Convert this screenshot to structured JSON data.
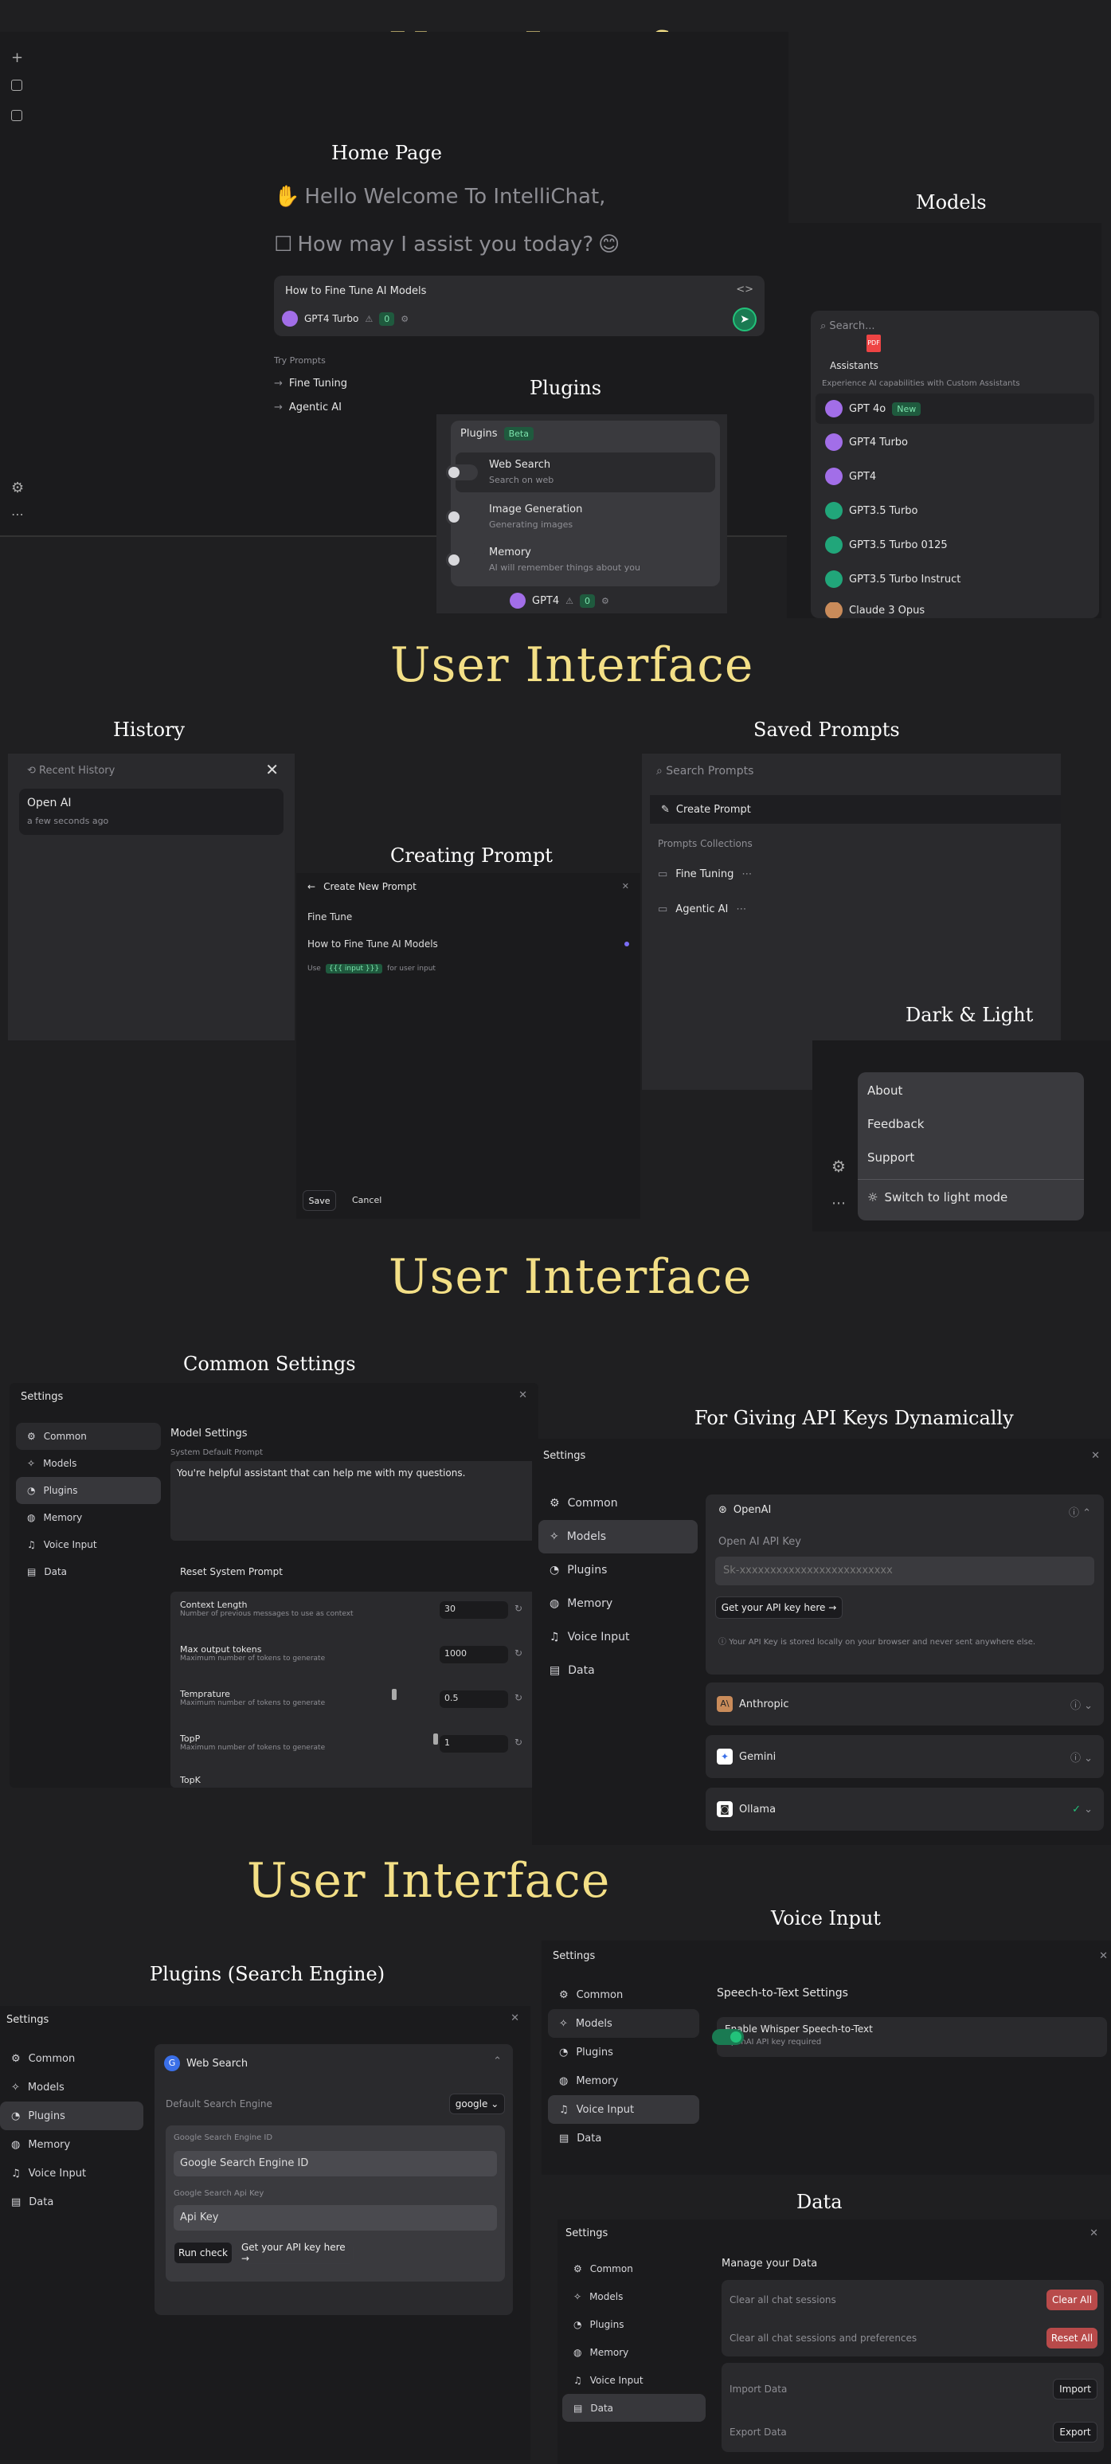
{
  "sections": [
    {
      "title": "User Interface"
    },
    {
      "title": "User Interface"
    },
    {
      "title": "User Interface"
    },
    {
      "title": "User Interface"
    }
  ],
  "home": {
    "label": "Home Page",
    "greeting1": "Hello Welcome To IntelliChat,",
    "greeting2": "How may I assist you today?",
    "greeting2_emoji": "😊",
    "input_value": "How to Fine Tune AI Models",
    "model_name": "GPT4 Turbo",
    "badge_count": "0",
    "try_prompts_label": "Try Prompts",
    "prompts": [
      "Fine Tuning",
      "Agentic AI"
    ]
  },
  "models": {
    "label": "Models",
    "search_placeholder": "Search...",
    "assistants_label": "Assistants",
    "assistants_desc": "Experience AI capabilities with Custom Assistants",
    "new_badge": "New",
    "items": [
      {
        "name": "GPT 4o",
        "color": "#a26ee8"
      },
      {
        "name": "GPT4 Turbo",
        "color": "#a26ee8"
      },
      {
        "name": "GPT4",
        "color": "#a26ee8"
      },
      {
        "name": "GPT3.5 Turbo",
        "color": "#21a67a"
      },
      {
        "name": "GPT3.5 Turbo 0125",
        "color": "#21a67a"
      },
      {
        "name": "GPT3.5 Turbo Instruct",
        "color": "#21a67a"
      },
      {
        "name": "Claude 3 Opus",
        "color": "#c98b5a"
      }
    ]
  },
  "plugins_popup": {
    "label": "Plugins",
    "header": "Plugins",
    "beta": "Beta",
    "items": [
      {
        "title": "Web Search",
        "desc": "Search on web"
      },
      {
        "title": "Image Generation",
        "desc": "Generating images"
      },
      {
        "title": "Memory",
        "desc": "AI will remember things about you"
      }
    ],
    "footer_model": "GPT4",
    "footer_count": "0"
  },
  "history": {
    "label": "History",
    "header": "Recent History",
    "item_title": "Open AI",
    "item_time": "a few seconds ago"
  },
  "saved_prompts": {
    "label": "Saved Prompts",
    "search_placeholder": "Search Prompts",
    "create": "Create Prompt",
    "collections_label": "Prompts Collections",
    "items": [
      "Fine Tuning",
      "Agentic AI"
    ]
  },
  "creating_prompt": {
    "label": "Creating Prompt",
    "header": "Create New Prompt",
    "name_value": "Fine Tune",
    "content_value": "How to Fine Tune AI Models",
    "hint_use": "Use",
    "hint_tag": "{{{ input }}}",
    "hint_rest": "for user input",
    "save": "Save",
    "cancel": "Cancel"
  },
  "dark_light": {
    "label": "Dark & Light",
    "items": [
      "About",
      "Feedback",
      "Support"
    ],
    "switch": "Switch to light mode"
  },
  "settings_nav": [
    "Common",
    "Models",
    "Plugins",
    "Memory",
    "Voice Input",
    "Data"
  ],
  "settings_title": "Settings",
  "common_settings": {
    "label": "Common Settings",
    "heading": "Model Settings",
    "system_prompt_label": "System Default Prompt",
    "system_prompt_value": "You're helpful assistant that can help me with my questions.",
    "reset": "Reset System Prompt",
    "params": [
      {
        "name": "Context Length",
        "desc": "Number of previous messages to use as context",
        "value": "30"
      },
      {
        "name": "Max output tokens",
        "desc": "Maximum number of tokens to generate",
        "value": "1000"
      },
      {
        "name": "Temprature",
        "desc": "Maximum number of tokens to generate",
        "value": "0.5"
      },
      {
        "name": "TopP",
        "desc": "Maximum number of tokens to generate",
        "value": "1"
      },
      {
        "name": "TopK",
        "desc": "",
        "value": ""
      }
    ]
  },
  "api_keys": {
    "label": "For Giving API Keys Dynamically",
    "openai": "OpenAI",
    "key_label": "Open AI API Key",
    "key_placeholder": "Sk-xxxxxxxxxxxxxxxxxxxxxxxxx",
    "get_key": "Get your API key here →",
    "note": "Your API Key is stored locally on your browser and never sent anywhere else.",
    "providers": [
      "Anthropic",
      "Gemini",
      "Ollama"
    ]
  },
  "plugins_search": {
    "label": "Plugins (Search Engine)",
    "web_search": "Web Search",
    "default_engine_label": "Default Search Engine",
    "engine": "google",
    "engine_id_label": "Google Search Engine ID",
    "engine_id_value": "Google Search Engine ID",
    "api_key_label": "Google Search Api Key",
    "api_key_value": "Api Key",
    "run_check": "Run check",
    "get_key": "Get your API key here →"
  },
  "voice_input": {
    "label": "Voice Input",
    "heading": "Speech-to-Text Settings",
    "toggle_title": "Enable Whisper Speech-to-Text",
    "toggle_desc": "OpenAI API key required"
  },
  "data_settings": {
    "label": "Data",
    "heading": "Manage your Data",
    "rows": [
      {
        "text": "Clear all chat sessions",
        "btn": "Clear All"
      },
      {
        "text": "Clear all chat sessions and preferences",
        "btn": "Reset All"
      },
      {
        "text": "Import Data",
        "btn": "Import"
      },
      {
        "text": "Export Data",
        "btn": "Export"
      }
    ]
  }
}
